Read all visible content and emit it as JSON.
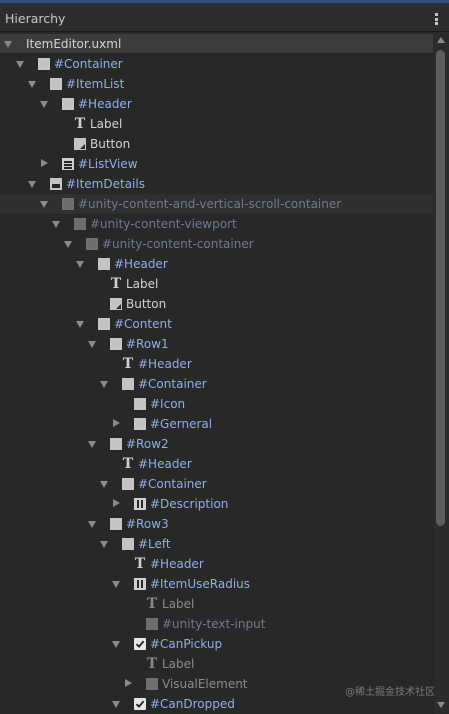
{
  "panel": {
    "title": "Hierarchy",
    "menu_icon": "kebab-menu-icon"
  },
  "tree": [
    {
      "label": "ItemEditor.uxml",
      "depth": 0,
      "expanded": true,
      "icon": "none",
      "style": "plain",
      "root": true
    },
    {
      "label": "#Container",
      "depth": 1,
      "expanded": true,
      "icon": "square",
      "style": "sel"
    },
    {
      "label": "#ItemList",
      "depth": 2,
      "expanded": true,
      "icon": "square",
      "style": "sel"
    },
    {
      "label": "#Header",
      "depth": 3,
      "expanded": true,
      "icon": "square",
      "style": "sel"
    },
    {
      "label": "Label",
      "depth": 4,
      "expanded": null,
      "icon": "text",
      "style": "plain"
    },
    {
      "label": "Button",
      "depth": 4,
      "expanded": null,
      "icon": "button",
      "style": "plain"
    },
    {
      "label": "#ListView",
      "depth": 3,
      "expanded": false,
      "icon": "list",
      "style": "sel"
    },
    {
      "label": "#ItemDetails",
      "depth": 2,
      "expanded": true,
      "icon": "details",
      "style": "sel"
    },
    {
      "label": "#unity-content-and-vertical-scroll-container",
      "depth": 3,
      "expanded": true,
      "icon": "square-dim",
      "style": "dimsel",
      "highlight": true
    },
    {
      "label": "#unity-content-viewport",
      "depth": 4,
      "expanded": true,
      "icon": "square-dim",
      "style": "dimsel"
    },
    {
      "label": "#unity-content-container",
      "depth": 5,
      "expanded": true,
      "icon": "square-dim",
      "style": "dimsel"
    },
    {
      "label": "#Header",
      "depth": 6,
      "expanded": true,
      "icon": "square",
      "style": "sel"
    },
    {
      "label": "Label",
      "depth": 7,
      "expanded": null,
      "icon": "text",
      "style": "plain"
    },
    {
      "label": "Button",
      "depth": 7,
      "expanded": null,
      "icon": "button",
      "style": "plain"
    },
    {
      "label": "#Content",
      "depth": 6,
      "expanded": true,
      "icon": "square",
      "style": "sel"
    },
    {
      "label": "#Row1",
      "depth": 7,
      "expanded": true,
      "icon": "square",
      "style": "sel"
    },
    {
      "label": "#Header",
      "depth": 8,
      "expanded": null,
      "icon": "text",
      "style": "sel"
    },
    {
      "label": "#Container",
      "depth": 8,
      "expanded": true,
      "icon": "square",
      "style": "sel"
    },
    {
      "label": "#Icon",
      "depth": 9,
      "expanded": null,
      "icon": "square",
      "style": "sel"
    },
    {
      "label": "#Gerneral",
      "depth": 9,
      "expanded": false,
      "icon": "square",
      "style": "sel"
    },
    {
      "label": "#Row2",
      "depth": 7,
      "expanded": true,
      "icon": "square",
      "style": "sel"
    },
    {
      "label": "#Header",
      "depth": 8,
      "expanded": null,
      "icon": "text",
      "style": "sel"
    },
    {
      "label": "#Container",
      "depth": 8,
      "expanded": true,
      "icon": "square",
      "style": "sel"
    },
    {
      "label": "#Description",
      "depth": 9,
      "expanded": false,
      "icon": "field",
      "style": "sel"
    },
    {
      "label": "#Row3",
      "depth": 7,
      "expanded": true,
      "icon": "square",
      "style": "sel"
    },
    {
      "label": "#Left",
      "depth": 8,
      "expanded": true,
      "icon": "square",
      "style": "sel"
    },
    {
      "label": "#Header",
      "depth": 9,
      "expanded": null,
      "icon": "text",
      "style": "sel"
    },
    {
      "label": "#ItemUseRadius",
      "depth": 9,
      "expanded": true,
      "icon": "field",
      "style": "sel"
    },
    {
      "label": "Label",
      "depth": 10,
      "expanded": null,
      "icon": "text-dim",
      "style": "dim"
    },
    {
      "label": "#unity-text-input",
      "depth": 10,
      "expanded": null,
      "icon": "square-dim",
      "style": "dimsel"
    },
    {
      "label": "#CanPickup",
      "depth": 9,
      "expanded": true,
      "icon": "check",
      "style": "sel"
    },
    {
      "label": "Label",
      "depth": 10,
      "expanded": null,
      "icon": "text-dim",
      "style": "dim"
    },
    {
      "label": "VisualElement",
      "depth": 10,
      "expanded": false,
      "icon": "square-dim",
      "style": "dim"
    },
    {
      "label": "#CanDropped",
      "depth": 9,
      "expanded": true,
      "icon": "check",
      "style": "sel"
    }
  ],
  "watermark": "@稀土掘金技术社区",
  "colors": {
    "background": "#282828",
    "selector_text": "#8fb0ea",
    "accent_line": "#2b4f7a"
  }
}
